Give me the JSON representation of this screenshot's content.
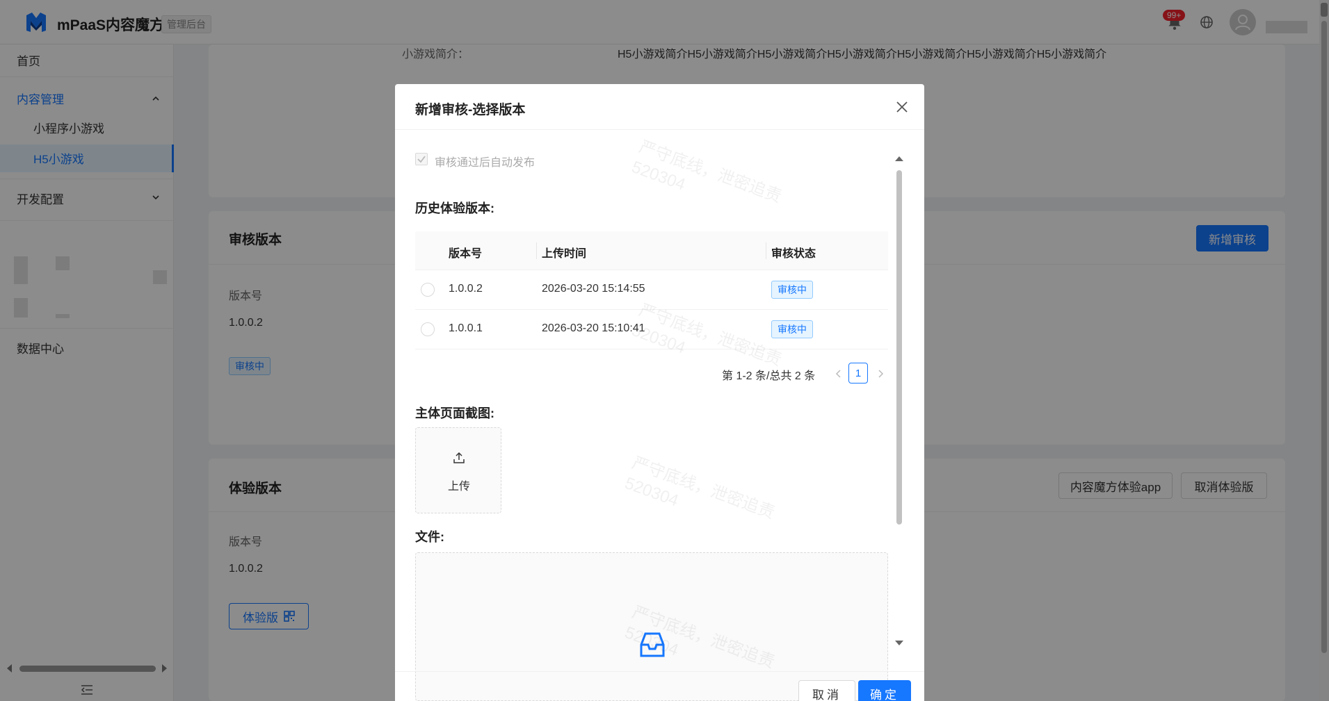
{
  "header": {
    "app_name": "mPaaS内容魔方",
    "admin_tag": "管理后台",
    "notification_badge": "99+"
  },
  "sidebar": {
    "home": "首页",
    "content_mgmt": "内容管理",
    "mini_program_games": "小程序小游戏",
    "h5_games": "H5小游戏",
    "dev_config": "开发配置",
    "data_center": "数据中心"
  },
  "page": {
    "intro_label": "小游戏简介：",
    "intro_value": "H5小游戏简介H5小游戏简介H5小游戏简介H5小游戏简介H5小游戏简介H5小游戏简介H5小游戏简介",
    "review_card": {
      "title": "审核版本",
      "add_button": "新增审核",
      "version_label": "版本号",
      "version_value": "1.0.0.2",
      "status": "审核中"
    },
    "trial_card": {
      "title": "体验版本",
      "app_button": "内容魔方体验app",
      "cancel_button": "取消体验版",
      "version_label": "版本号",
      "version_value": "1.0.0.2",
      "trial_button": "体验版"
    }
  },
  "modal": {
    "title": "新增审核-选择版本",
    "auto_publish_label": "审核通过后自动发布",
    "history_title": "历史体验版本:",
    "table": {
      "headers": [
        "版本号",
        "上传时间",
        "审核状态"
      ],
      "rows": [
        {
          "version": "1.0.0.2",
          "time": "2026-03-20 15:14:55",
          "status": "审核中"
        },
        {
          "version": "1.0.0.1",
          "time": "2026-03-20 15:10:41",
          "status": "审核中"
        }
      ]
    },
    "pagination": {
      "summary": "第 1-2 条/总共 2 条",
      "current": "1"
    },
    "screenshot_title": "主体页面截图:",
    "upload_label": "上传",
    "file_title": "文件:",
    "cancel": "取消",
    "ok": "确定"
  },
  "watermark": {
    "line1": "严守底线，泄密追责",
    "line2": "520304"
  }
}
